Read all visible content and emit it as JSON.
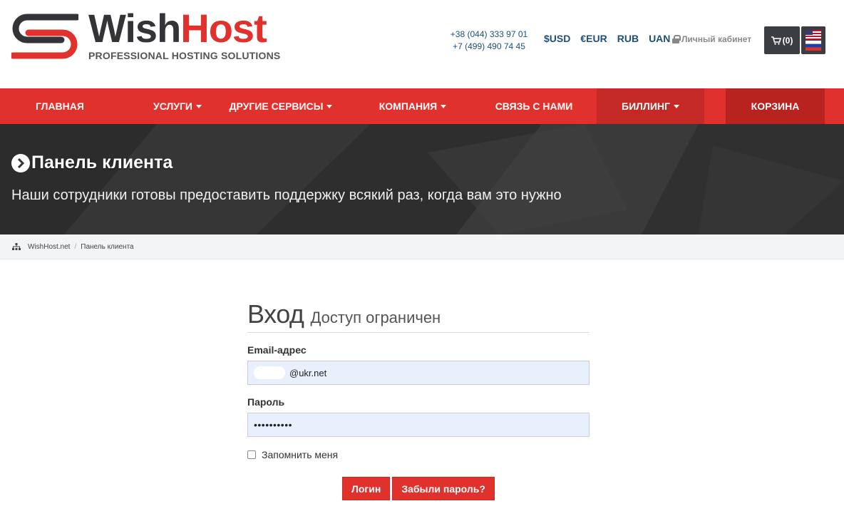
{
  "brand": {
    "word_1": "Wish",
    "word_2": "Host",
    "tagline": "PROFESSIONAL HOSTING SOLUTIONS",
    "colors": {
      "red": "#e0312d",
      "dark": "#333338"
    }
  },
  "contacts": {
    "phone_1": "+38 (044) 333 97 01",
    "phone_2": "+7 (499) 490 74 45"
  },
  "currencies": [
    "$USD",
    "€EUR",
    "RUB",
    "UAN"
  ],
  "account": {
    "label": "Личный кабинет",
    "icon": "lock-icon"
  },
  "cart_button": {
    "label": "(0)",
    "icon": "cart-icon"
  },
  "language": {
    "icon": "us-flag-icon"
  },
  "nav": {
    "items": [
      {
        "label": "ГЛАВНАЯ",
        "dropdown": false
      },
      {
        "label": "УСЛУГИ",
        "dropdown": true
      },
      {
        "label": "ДРУГИЕ СЕРВИСЫ",
        "dropdown": true
      },
      {
        "label": "КОМПАНИЯ",
        "dropdown": true
      },
      {
        "label": "СВЯЗЬ С НАМИ",
        "dropdown": false
      },
      {
        "label": "БИЛЛИНГ",
        "dropdown": true
      },
      {
        "label": "КОРЗИНА",
        "dropdown": false
      }
    ]
  },
  "hero": {
    "title": "Панель клиента",
    "subtitle": "Наши сотрудники готовы предоставить поддержку всякий раз, когда вам это нужно"
  },
  "breadcrumb": {
    "items": [
      "WishHost.net",
      "Панель клиента"
    ],
    "separator": "/"
  },
  "login": {
    "title": "Вход",
    "subtitle": "Доступ ограничен",
    "email_label": "Email-адрес",
    "email_value": "@ukr.net",
    "password_label": "Пароль",
    "password_value": "••••••••••",
    "remember_label": "Запомнить меня",
    "login_button": "Логин",
    "forgot_button": "Забыли пароль?"
  }
}
